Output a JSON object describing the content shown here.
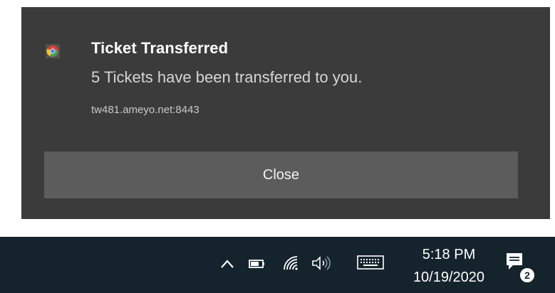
{
  "toast": {
    "title": "Ticket Transferred",
    "message": "5 Tickets have been transferred to you.",
    "source": "tw481.ameyo.net:8443",
    "close_label": "Close",
    "app_icon": "chrome-icon"
  },
  "taskbar": {
    "time": "5:18 PM",
    "date": "10/19/2020",
    "notification_count": "2",
    "tray_icons": [
      "chevron-up-icon",
      "battery-icon",
      "wifi-icon",
      "volume-icon",
      "keyboard-icon",
      "notification-center-icon"
    ]
  },
  "colors": {
    "toast_bg": "#3b3b3b",
    "button_bg": "#5c5c5c",
    "taskbar_bg": "#15232d"
  }
}
